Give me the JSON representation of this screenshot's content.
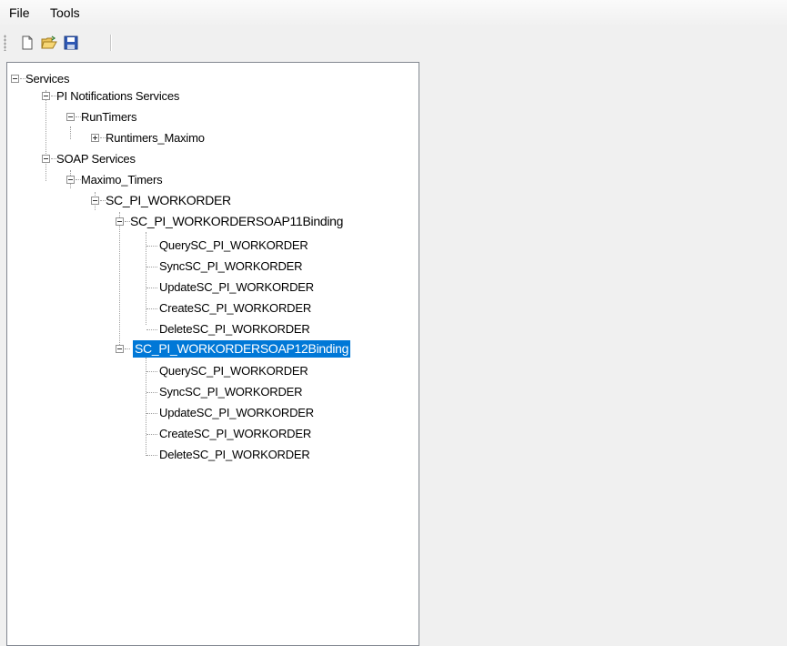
{
  "menu": {
    "file": "File",
    "tools": "Tools"
  },
  "toolbar": {
    "new": "new-document-icon",
    "open": "open-folder-icon",
    "save": "save-icon"
  },
  "tree": {
    "services": "Services",
    "pi_notifications": "PI Notifications Services",
    "runtimers": "RunTimers",
    "runtimers_maximo": "Runtimers_Maximo",
    "soap_services": "SOAP Services",
    "maximo_timers": "Maximo_Timers",
    "sc_pi_workorder": "SC_PI_WORKORDER",
    "binding11": "SC_PI_WORKORDERSOAP11Binding",
    "binding11_ops": [
      "QuerySC_PI_WORKORDER",
      "SyncSC_PI_WORKORDER",
      "UpdateSC_PI_WORKORDER",
      "CreateSC_PI_WORKORDER",
      "DeleteSC_PI_WORKORDER"
    ],
    "binding12": "SC_PI_WORKORDERSOAP12Binding",
    "binding12_ops": [
      "QuerySC_PI_WORKORDER",
      "SyncSC_PI_WORKORDER",
      "UpdateSC_PI_WORKORDER",
      "CreateSC_PI_WORKORDER",
      "DeleteSC_PI_WORKORDER"
    ]
  }
}
